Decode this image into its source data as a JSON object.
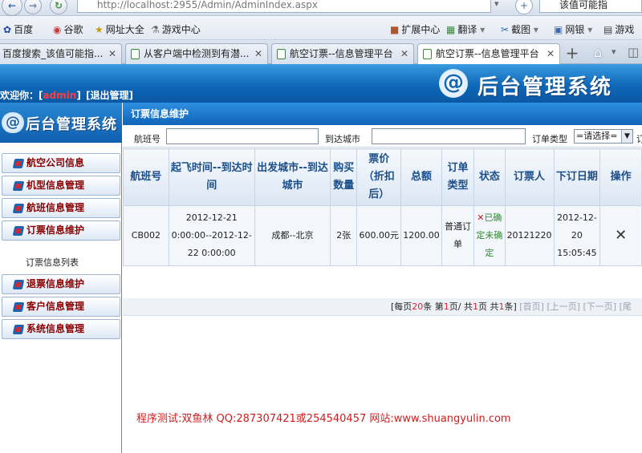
{
  "browser": {
    "url": "http://localhost:2955/Admin/AdminIndex.aspx",
    "search_snippet": "该值可能指",
    "bookmarks": [
      {
        "label": "百度",
        "icon": "paw-icon"
      },
      {
        "label": "谷歌",
        "icon": "google-icon"
      },
      {
        "label": "网址大全",
        "icon": "star-icon"
      },
      {
        "label": "游戏中心",
        "icon": "gamepad-icon"
      }
    ],
    "toolbar_right": [
      {
        "label": "扩展中心",
        "icon": "cube-icon"
      },
      {
        "label": "翻译",
        "icon": "translate-icon"
      },
      {
        "label": "截图",
        "icon": "scissors-icon"
      },
      {
        "label": "网银",
        "icon": "bank-icon"
      },
      {
        "label": "游戏",
        "icon": "game-icon"
      }
    ],
    "tabs": [
      {
        "title": "百度搜索_该值可能指..."
      },
      {
        "title": "从客户端中检测到有潜..."
      },
      {
        "title": "航空订票--信息管理平台"
      },
      {
        "title": "航空订票--信息管理平台"
      }
    ],
    "new_tab_label": "+"
  },
  "header": {
    "welcome_prefix": "欢迎你：",
    "user_bracket_open": "[",
    "username": "admin",
    "user_bracket_close": "]",
    "logout": "[退出管理]",
    "brand_mark": "@",
    "brand_title": "后台管理系统"
  },
  "sidebar": {
    "logo_text": "后台管理系统",
    "menu": [
      {
        "label": "航空公司信息"
      },
      {
        "label": "机型信息管理"
      },
      {
        "label": "航班信息管理"
      },
      {
        "label": "订票信息维护"
      },
      {
        "label": "退票信息维护"
      },
      {
        "label": "客户信息管理"
      },
      {
        "label": "系统信息管理"
      }
    ],
    "submenu_label": "订票信息列表"
  },
  "main": {
    "panel_title": "订票信息维护",
    "search": {
      "flight_label": "航班号",
      "flight_value": "",
      "city_label": "到达城市",
      "city_value": "",
      "type_label": "订单类型",
      "type_selected": "=请选择=",
      "trailing": "订"
    },
    "table": {
      "headers": [
        "航班号",
        "起飞时间--到达时间",
        "出发城市--到达城市",
        "购买数量",
        "票价（折扣后）",
        "总额",
        "订单类型",
        "状态",
        "订票人",
        "下订日期",
        "操作"
      ],
      "rows": [
        {
          "flight": "CB002",
          "time": "2012-12-21 0:00:00--2012-12-22 0:00:00",
          "route": "成都--北京",
          "quantity": "2张",
          "price": "600.00元",
          "total": "1200.00",
          "order_type": "普通订单",
          "status_mark": "✕",
          "status_text": "已确定",
          "status_text2": "未确定",
          "booker": "20121220",
          "order_date": "2012-12-20 15:05:45",
          "action": "✕"
        }
      ]
    },
    "pager": {
      "per_page_prefix": "[每页",
      "per_page": "20",
      "per_page_suffix": "条",
      "page_prefix": "第",
      "page": "1",
      "page_suffix": "页/ 共",
      "pages": "1",
      "pages_suffix": "页 共",
      "count": "1",
      "count_suffix": "条]",
      "first": "[首页]",
      "prev": "[上一页]",
      "next": "[下一页]",
      "last": "[尾"
    },
    "credit": "程序测试:双鱼林  QQ:287307421或254540457 网站:www.shuangyulin.com"
  },
  "colors": {
    "header_blue": "#0f68b9",
    "menu_text": "#8b0000",
    "credit_red": "#d01c1c",
    "table_header": "#1b4f8a"
  }
}
